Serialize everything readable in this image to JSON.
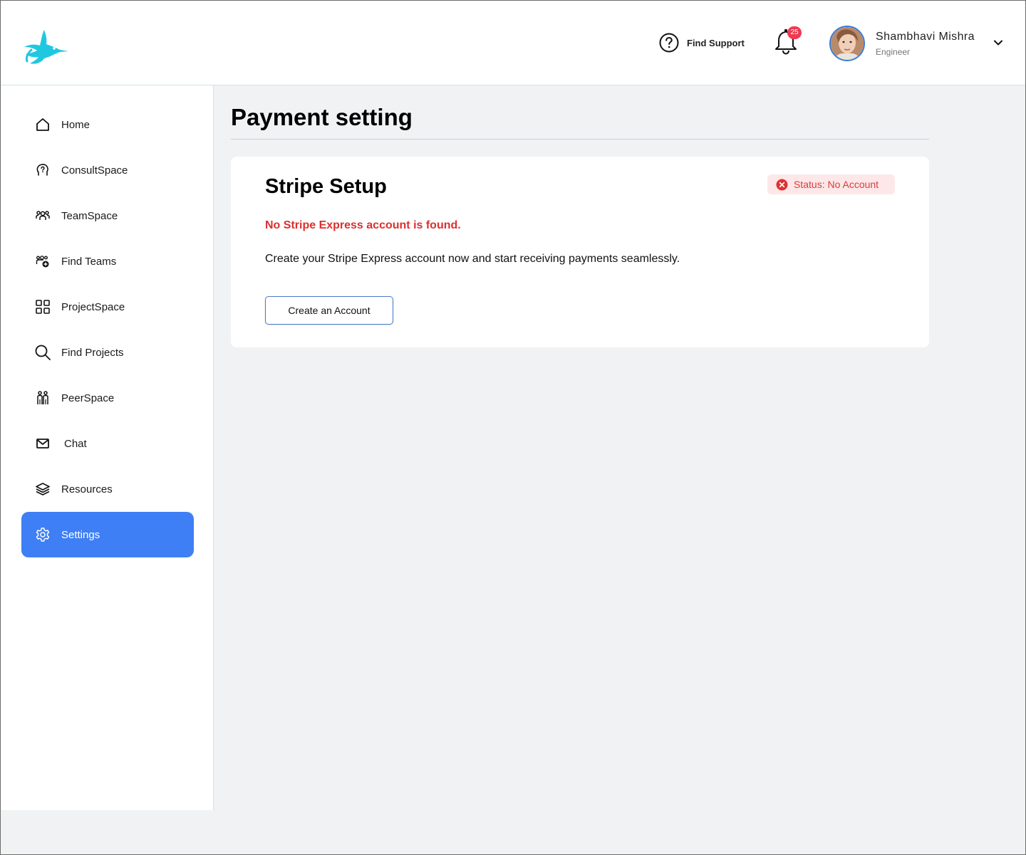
{
  "header": {
    "support_label": "Find Support",
    "notification_count": "25",
    "user": {
      "name": "Shambhavi Mishra",
      "role": "Engineer"
    }
  },
  "sidebar": {
    "items": [
      {
        "label": "Home",
        "icon": "home-icon"
      },
      {
        "label": "ConsultSpace",
        "icon": "consult-icon"
      },
      {
        "label": "TeamSpace",
        "icon": "team-icon"
      },
      {
        "label": "Find Teams",
        "icon": "find-teams-icon"
      },
      {
        "label": "ProjectSpace",
        "icon": "grid-icon"
      },
      {
        "label": "Find Projects",
        "icon": "search-icon"
      },
      {
        "label": "PeerSpace",
        "icon": "peers-icon"
      },
      {
        "label": "Chat",
        "icon": "mail-icon"
      },
      {
        "label": "Resources",
        "icon": "layers-icon"
      },
      {
        "label": "Settings",
        "icon": "gear-icon",
        "active": true
      }
    ]
  },
  "main": {
    "title": "Payment setting",
    "card": {
      "title": "Stripe Setup",
      "status": "Status: No Account",
      "error": "No Stripe Express account is found.",
      "description": "Create your Stripe Express account now and start receiving payments seamlessly.",
      "button": "Create an Account"
    }
  },
  "colors": {
    "accent": "#3f7ff5",
    "error": "#dc2f2f",
    "logo": "#1fc8e0",
    "badge": "#ef3a4f"
  }
}
